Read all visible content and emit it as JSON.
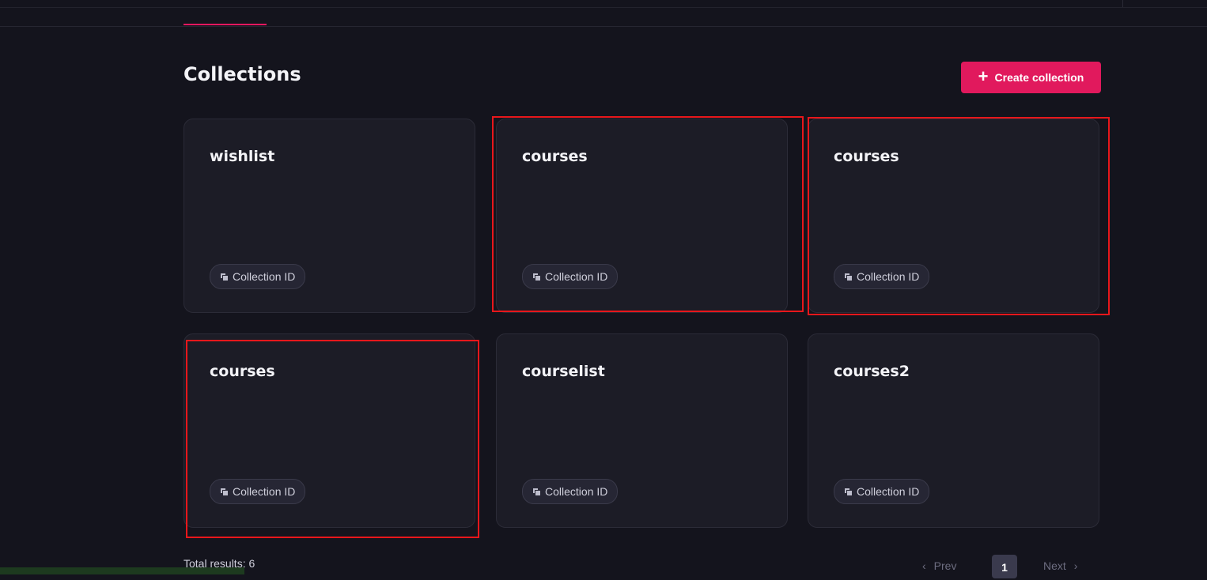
{
  "page": {
    "title": "Collections",
    "create_button_label": "Create collection",
    "total_results": "Total results: 6"
  },
  "collections": [
    {
      "name": "wishlist",
      "id_label": "Collection ID",
      "highlighted": false
    },
    {
      "name": "courses",
      "id_label": "Collection ID",
      "highlighted": true
    },
    {
      "name": "courses",
      "id_label": "Collection ID",
      "highlighted": true
    },
    {
      "name": "courses",
      "id_label": "Collection ID",
      "highlighted": true
    },
    {
      "name": "courselist",
      "id_label": "Collection ID",
      "highlighted": false
    },
    {
      "name": "courses2",
      "id_label": "Collection ID",
      "highlighted": false
    }
  ],
  "pagination": {
    "prev_label": "Prev",
    "current_page": "1",
    "next_label": "Next"
  },
  "colors": {
    "background": "#14141d",
    "card": "#1c1c26",
    "accent": "#e1195d",
    "highlight": "#e8171b"
  }
}
